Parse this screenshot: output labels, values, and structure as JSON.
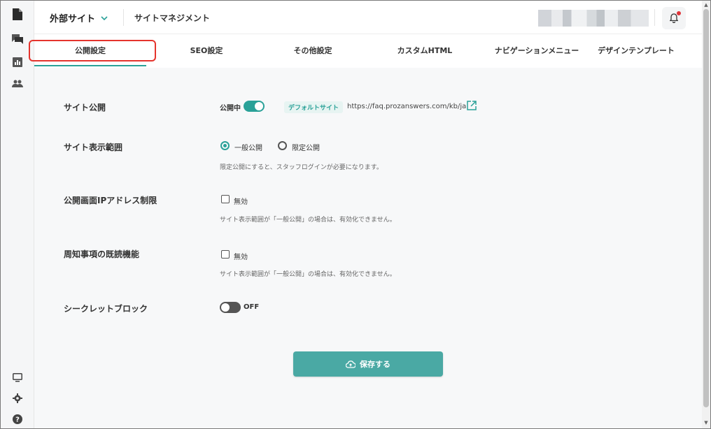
{
  "header": {
    "site_select": "外部サイト",
    "title": "サイトマネジメント"
  },
  "tabs": [
    {
      "label": "公開設定"
    },
    {
      "label": "SEO設定"
    },
    {
      "label": "その他設定"
    },
    {
      "label": "カスタムHTML"
    },
    {
      "label": "ナビゲーションメニュー"
    },
    {
      "label": "デザインテンプレート"
    }
  ],
  "settings": {
    "site_publish": {
      "label": "サイト公開",
      "status": "公開中",
      "badge": "デフォルトサイト",
      "url": "https://faq.prozanswers.com/kb/ja"
    },
    "display_scope": {
      "label": "サイト表示範囲",
      "option_public": "一般公開",
      "option_limited": "限定公開",
      "note": "限定公開にすると、スタッフログインが必要になります。"
    },
    "ip_restriction": {
      "label": "公開画面IPアドレス制限",
      "checkbox_label": "無効",
      "note": "サイト表示範囲が「一般公開」の場合は、有効化できません。"
    },
    "read_receipt": {
      "label": "周知事項の既読機能",
      "checkbox_label": "無効",
      "note": "サイト表示範囲が「一般公開」の場合は、有効化できません。"
    },
    "secret_block": {
      "label": "シークレットブロック",
      "status": "OFF"
    }
  },
  "save_button": "保存する",
  "colors": {
    "accent": "#2aa198",
    "save": "#4aa9a4",
    "highlight": "#e5342d",
    "toggle_off": "#555555"
  }
}
